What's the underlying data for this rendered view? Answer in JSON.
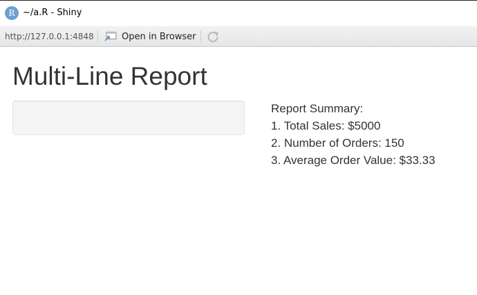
{
  "window": {
    "icon_letter": "R",
    "title": "~/a.R - Shiny"
  },
  "toolbar": {
    "url": "http://127.0.0.1:4848",
    "open_in_browser_label": "Open in Browser"
  },
  "page": {
    "title": "Multi-Line Report",
    "summary": {
      "heading": "Report Summary:",
      "lines": [
        "1. Total Sales: $5000",
        "2. Number of Orders: 150",
        "3. Average Order Value: $33.33"
      ]
    }
  }
}
